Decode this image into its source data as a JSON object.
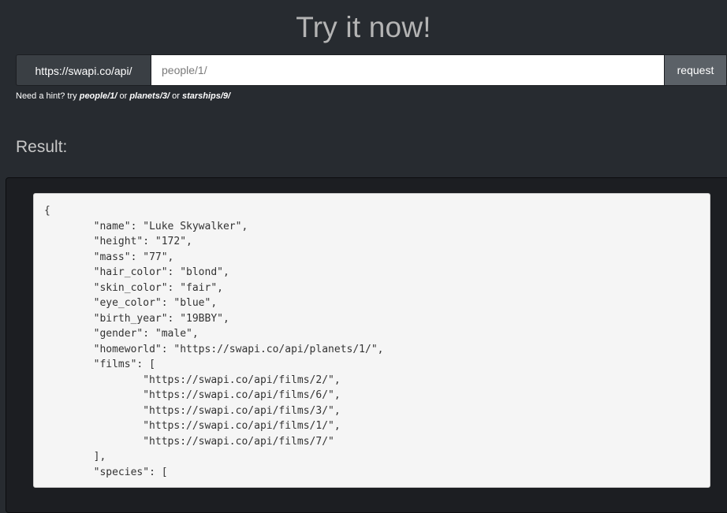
{
  "title": "Try it now!",
  "request": {
    "base_url": "https://swapi.co/api/",
    "path_value": "people/1/",
    "button_label": "request"
  },
  "hint": {
    "prefix": "Need a hint? try ",
    "links": [
      "people/1/",
      "planets/3/",
      "starships/9/"
    ],
    "separator": " or "
  },
  "result": {
    "heading": "Result:",
    "lines": [
      "{",
      "\t\"name\": \"Luke Skywalker\",",
      "\t\"height\": \"172\",",
      "\t\"mass\": \"77\",",
      "\t\"hair_color\": \"blond\",",
      "\t\"skin_color\": \"fair\",",
      "\t\"eye_color\": \"blue\",",
      "\t\"birth_year\": \"19BBY\",",
      "\t\"gender\": \"male\",",
      "\t\"homeworld\": \"https://swapi.co/api/planets/1/\",",
      "\t\"films\": [",
      "\t\t\"https://swapi.co/api/films/2/\",",
      "\t\t\"https://swapi.co/api/films/6/\",",
      "\t\t\"https://swapi.co/api/films/3/\",",
      "\t\t\"https://swapi.co/api/films/1/\",",
      "\t\t\"https://swapi.co/api/films/7/\"",
      "\t],",
      "\t\"species\": ["
    ]
  }
}
